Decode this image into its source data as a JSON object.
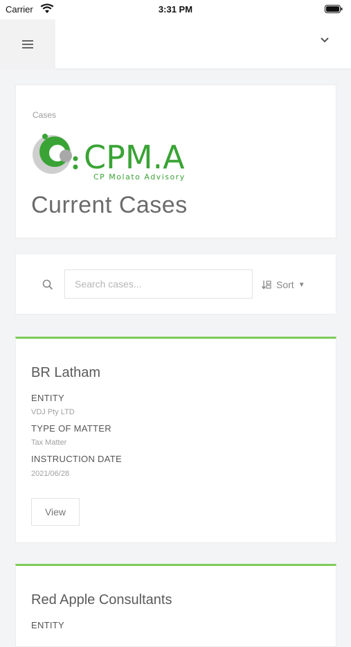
{
  "status_bar": {
    "carrier": "Carrier",
    "time": "3:31 PM"
  },
  "header_card": {
    "breadcrumb": "Cases",
    "logo_text": "CPM.A",
    "logo_subtext": "CP Molato Advisory",
    "title": "Current Cases"
  },
  "search": {
    "placeholder": "Search cases...",
    "sort_label": "Sort"
  },
  "cases": [
    {
      "name": "BR Latham",
      "entity_label": "ENTITY",
      "entity": "VDJ Pty LTD",
      "matter_label": "TYPE OF MATTER",
      "matter": "Tax Matter",
      "date_label": "INSTRUCTION DATE",
      "date": "2021/06/28",
      "view_label": "View"
    },
    {
      "name": "Red Apple Consultants",
      "entity_label": "ENTITY"
    }
  ],
  "colors": {
    "accent": "#7ecb5a",
    "logo_green": "#3aa335",
    "logo_gray": "#8a8a8a"
  }
}
